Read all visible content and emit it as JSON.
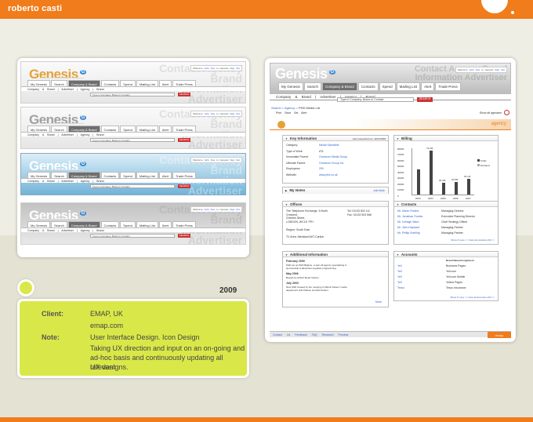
{
  "site": {
    "brand": "roberto casti"
  },
  "thumbnails": {
    "logo": "Genesis",
    "welcome_prefix": "Welcome",
    "user": "John Doe",
    "to_genesis": "to Genesis",
    "sign_out": "Sign Out",
    "nav": [
      "My Genesis",
      "Search",
      "Company & Brand",
      "Contacts",
      "Spend",
      "Mailing List",
      "Alert",
      "Trade Press"
    ],
    "sub_nav": "Company & Brand  |  Advertiser  |  Agency  |  Brand",
    "search_placeholder": "Type in Company, Brand or Contact",
    "search_button": "SEARCH",
    "watermark": "Contact Agency Brand Information Advertiser"
  },
  "project": {
    "year": "2009",
    "client_label": "Client:",
    "client": "EMAP, UK",
    "url": "emap.com",
    "note_label": "Note:",
    "note_line1": "User Interface Design. Icon Design",
    "note_line2": "Taking UX direction and input on an on-going and",
    "note_line3": "ad-hoc basis and continuously updating all relevant",
    "note_line4": "UX designs."
  },
  "detail": {
    "logo": "Genesis",
    "welcome_prefix": "Welcome",
    "user": "John Doe",
    "to_genesis": "to Genesis",
    "sign_out": "Sign Out",
    "nav": [
      "My Genesis",
      "Search",
      "Company & Brand",
      "Contacts",
      "Spend",
      "Mailing List",
      "Alert",
      "Trade Press"
    ],
    "sub_nav": "Company & Brand  |  Advertiser  |  Agency  |  Brand",
    "search_placeholder": "Type in Company, Brand or Contact",
    "search_button": "SEARCH",
    "breadcrumb_prefix": "Search > Agency >",
    "breadcrumb_current": "PHD Media Ltd",
    "tools": "Print  Save  Set Alert",
    "show_all": "Show all agencies",
    "agency_label": "agency",
    "key_info": {
      "title": "Key Information",
      "last_researched": "Last researched on: 11/07/2009",
      "rows": [
        {
          "k": "Category:",
          "v": "Media Specialist"
        },
        {
          "k": "Type of Work:",
          "v": "ATL"
        },
        {
          "k": "Immediate Parent:",
          "v": "Omnicom Media Group"
        },
        {
          "k": "Ultimate Parent:",
          "v": "Omnicom Group Inc"
        },
        {
          "k": "Employees:",
          "v": "200"
        },
        {
          "k": "Website:",
          "v": "www.phd.co.uk"
        }
      ]
    },
    "billing": {
      "title": "Billing",
      "legend": [
        "Totals",
        "Declared"
      ]
    },
    "my_notes": {
      "title": "My Notes",
      "add": "Add Note"
    },
    "offices": {
      "title": "Offices",
      "address": [
        "The Telephone Exchange, 5 North",
        "Crescent,",
        "Chenies Street,",
        "LONDON, WC1E 7PH"
      ],
      "tel": "Tel: 01133 502 111",
      "fax": "Fax: 01133 503 568",
      "region": "Region: South East",
      "tv_area": "TV Area: Meridian/LWT-Carlton"
    },
    "contacts": {
      "title": "Contacts",
      "rows": [
        {
          "name": "Mr. Daren Rubins",
          "role": "Managing Director"
        },
        {
          "name": "Mr. Jonathan Fowles",
          "role": "Executive Planning Director"
        },
        {
          "name": "Mr. Cretagh Ward",
          "role": "Chief Strategy Officer"
        },
        {
          "name": "Mr. John Hayward",
          "role": "Managing Partner"
        },
        {
          "name": "Mr. Phillip Snelling",
          "role": "Managing Partner"
        }
      ],
      "more": "Show 5 more >>    View all contacts (23) >>"
    },
    "additional": {
      "title": "Additional Information",
      "entries": [
        {
          "date": "February 2009",
          "text": [
            "PHD set up PHD Bigtime, a spin-off agency specialising in",
            "sponsorship & advertiser-supplied programming."
          ]
        },
        {
          "date": "May 2006",
          "text": [
            "Bought by Abbott Mead Vickers"
          ]
        },
        {
          "date": "July 2003",
          "text": [
            "New PHD created by the merging of Abbott Vickers' media",
            "department with Paltson Horwell Durden."
          ]
        }
      ],
      "more": "More"
    },
    "accounts": {
      "title": "Accounts",
      "header": "Brand Name/Assignment",
      "rows": [
        {
          "name": "Yell",
          "brand": "Business Pages"
        },
        {
          "name": "Yell",
          "brand": "Yell.com"
        },
        {
          "name": "Yell",
          "brand": "Yell.com Mobile"
        },
        {
          "name": "Yell",
          "brand": "Yellow Pages"
        },
        {
          "name": "Tesco",
          "brand": "Tesco Insurance"
        }
      ],
      "more": "Show 5 more >>    View all accounts (23) >>"
    },
    "footer": "Contact Us   Feedback   FAQ   Research Process",
    "footer_brand": "emap"
  },
  "chart_data": {
    "type": "bar",
    "categories": [
      "2003",
      "2004",
      "2005",
      "2006",
      "2007"
    ],
    "series": [
      {
        "name": "Totals",
        "values": [
          42.5,
          74.2,
          20.3,
          20.8,
          26.1
        ]
      },
      {
        "name": "Declared",
        "values": [
          0,
          0,
          0,
          0,
          0
        ]
      }
    ],
    "value_labels": [
      "",
      "74.2M",
      "20.3M",
      "20.8M",
      "26.1M"
    ],
    "yticks": [
      "80000",
      "70000",
      "60000",
      "50000",
      "40000",
      "30000",
      "20000",
      "10000",
      "0"
    ],
    "ylim": [
      0,
      80
    ]
  }
}
